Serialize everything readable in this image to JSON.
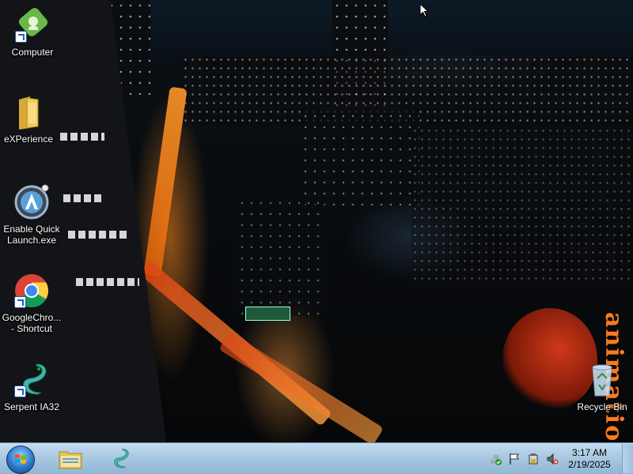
{
  "desktop": {
    "icons": [
      {
        "label": "Computer",
        "icon": "computer-icon"
      },
      {
        "label": "eXPerience",
        "icon": "folder-icon"
      },
      {
        "label": "Enable Quick Launch.exe",
        "icon": "quicklaunch-app-icon"
      },
      {
        "label": "GoogleChro... - Shortcut",
        "icon": "chrome-icon"
      },
      {
        "label": "Serpent IA32",
        "icon": "serpent-icon"
      },
      {
        "label": "Recycle Bin",
        "icon": "recycle-bin-icon"
      }
    ],
    "wallpaper_logo": "animation"
  },
  "taskbar": {
    "start_label": "Start",
    "pinned": [
      {
        "name": "Windows Explorer",
        "icon": "explorer-folder-icon"
      },
      {
        "name": "Serpent",
        "icon": "serpent-icon"
      }
    ],
    "tray_icons": [
      "network-icon",
      "action-center-flag-icon",
      "power-icon",
      "volume-muted-icon"
    ],
    "clock": {
      "time": "3:17 AM",
      "date": "2/19/2025"
    }
  }
}
